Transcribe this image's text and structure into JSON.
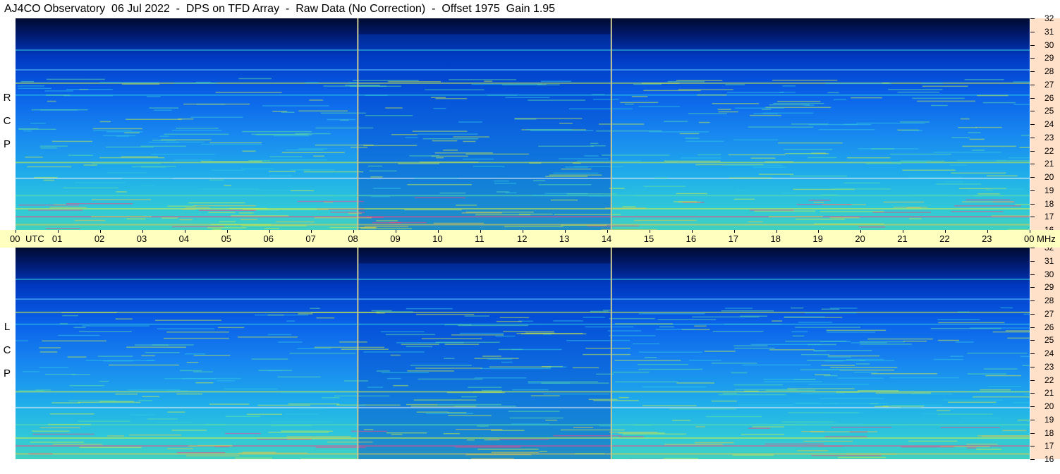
{
  "title": "AJ4CO Observatory  06 Jul 2022  -  DPS on TFD Array  -  Raw Data (No Correction)  -  Offset 1975  Gain 1.95",
  "chart_data": [
    {
      "type": "heatmap",
      "polarization": "RCP",
      "pol_letters": [
        "R",
        "C",
        "P"
      ],
      "x_unit": "UTC",
      "y_unit": "MHz",
      "xlim": [
        0,
        24
      ],
      "ylim": [
        16,
        32
      ],
      "x_ticks": [
        "00",
        "01",
        "02",
        "03",
        "04",
        "05",
        "06",
        "07",
        "08",
        "09",
        "10",
        "11",
        "12",
        "13",
        "14",
        "15",
        "16",
        "17",
        "18",
        "19",
        "20",
        "21",
        "22",
        "23",
        "00"
      ],
      "y_ticks": [
        16,
        17,
        18,
        19,
        20,
        21,
        22,
        23,
        24,
        25,
        26,
        27,
        28,
        29,
        30,
        31,
        32
      ],
      "markers_utc": [
        8.1,
        14.1
      ],
      "persistent_bands_mhz": [
        16.4,
        17.0,
        17.6,
        18.6,
        19.9,
        21.1,
        26.2,
        27.1,
        28.1,
        29.6
      ],
      "colorscale": [
        "#000a30",
        "#0028a0",
        "#0050e0",
        "#1a90f0",
        "#30c8e0",
        "#60e0a0",
        "#d0f040",
        "#f0c840",
        "#ff4080"
      ]
    },
    {
      "type": "heatmap",
      "polarization": "LCP",
      "pol_letters": [
        "L",
        "C",
        "P"
      ],
      "x_unit": "UTC",
      "y_unit": "MHz",
      "xlim": [
        0,
        24
      ],
      "ylim": [
        16,
        32
      ],
      "x_ticks": [
        "00",
        "01",
        "02",
        "03",
        "04",
        "05",
        "06",
        "07",
        "08",
        "09",
        "10",
        "11",
        "12",
        "13",
        "14",
        "15",
        "16",
        "17",
        "18",
        "19",
        "20",
        "21",
        "22",
        "23",
        "00"
      ],
      "y_ticks": [
        16,
        17,
        18,
        19,
        20,
        21,
        22,
        23,
        24,
        25,
        26,
        27,
        28,
        29,
        30,
        31,
        32
      ],
      "markers_utc": [
        8.1,
        14.1
      ],
      "persistent_bands_mhz": [
        16.4,
        17.0,
        17.6,
        18.6,
        19.9,
        21.1,
        26.2,
        27.1,
        28.1,
        29.6
      ],
      "colorscale": [
        "#000a30",
        "#0028a0",
        "#0050e0",
        "#1a90f0",
        "#30c8e0",
        "#60e0a0",
        "#d0f040",
        "#f0c840",
        "#ff4080"
      ]
    }
  ],
  "time_axis": {
    "utc_label": "UTC",
    "mhz_label": "MHz"
  }
}
